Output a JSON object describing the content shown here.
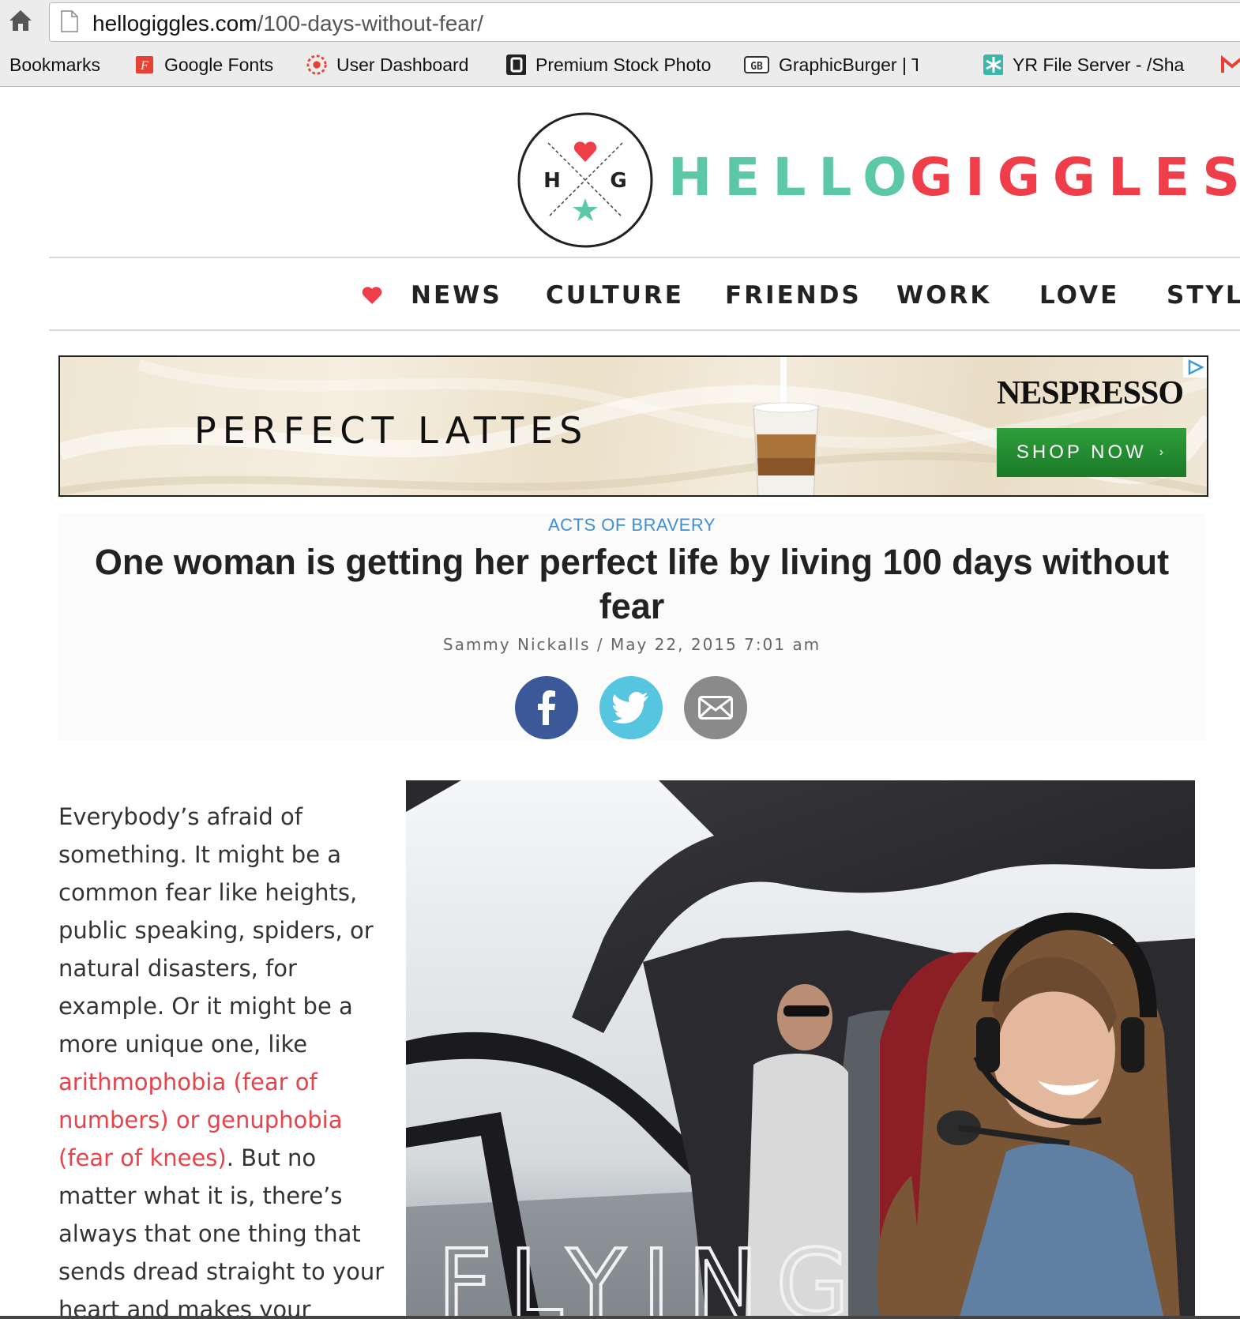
{
  "browser": {
    "url_domain": "hellogiggles.com",
    "url_path": "/100-days-without-fear/",
    "bookmarks_label": "Bookmarks",
    "bookmarks": [
      {
        "label": "Google Fonts",
        "icon": "google-fonts-icon"
      },
      {
        "label": "User Dashboard",
        "icon": "dashboard-icon"
      },
      {
        "label": "Premium Stock Photo",
        "icon": "stock-photo-icon"
      },
      {
        "label": "GraphicBurger | Tasty",
        "icon": "graphicburger-icon"
      },
      {
        "label": "YR File Server - /Sha",
        "icon": "file-server-icon"
      }
    ]
  },
  "site": {
    "logo_letters": {
      "left": "H",
      "right": "G"
    },
    "logo_hello": "HELLO",
    "logo_giggles": "GIGGLES",
    "nav": [
      "NEWS",
      "CULTURE",
      "FRIENDS",
      "WORK",
      "LOVE",
      "STYLE"
    ],
    "colors": {
      "mint": "#5dc8a7",
      "red": "#ef3e4a",
      "link_blue": "#3f8fd6"
    }
  },
  "ad": {
    "headline": "PERFECT LATTES",
    "brand": "NESPRESSO",
    "cta": "SHOP NOW",
    "cta_arrow": "›"
  },
  "article": {
    "category": "ACTS OF BRAVERY",
    "title": "One woman is getting her perfect life by living 100 days without fear",
    "byline": "Sammy Nickalls / May 22, 2015 7:01 am",
    "share": [
      {
        "name": "facebook",
        "color": "#3b5998"
      },
      {
        "name": "twitter",
        "color": "#55c5e0"
      },
      {
        "name": "email",
        "color": "#8a8a8a"
      }
    ],
    "body_before_link": "Everybody’s afraid of something. It might be a common fear like heights, public speaking, spiders, or natural disasters, for example. Or it might be a more unique one, like ",
    "body_link": "arithmophobia (fear of numbers) or genuphobia (fear of knees)",
    "body_after_link": ". But no matter what it is, there’s always that one thing that sends dread straight to your heart and makes your",
    "photo_caption": "FLYING"
  }
}
